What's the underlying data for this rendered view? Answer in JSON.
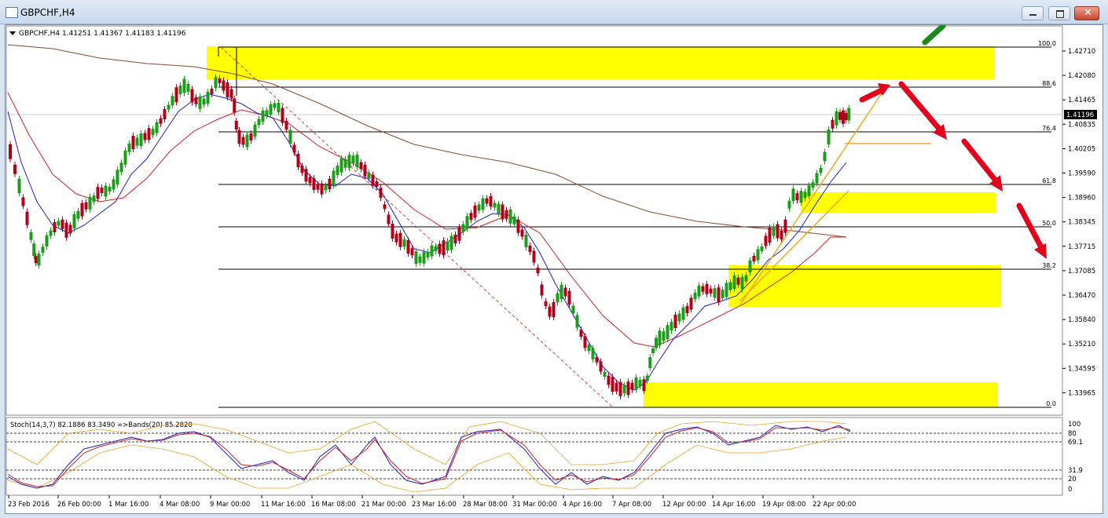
{
  "window": {
    "title": "GBPCHF,H4",
    "buttons": [
      "minimize",
      "maximize",
      "close"
    ]
  },
  "chart": {
    "info_line": "GBPCHF,H4  1.41251 1.41367 1.41183 1.41196",
    "current_price": "1.41196",
    "price_ticks": [
      "1.42710",
      "1.42080",
      "1.41465",
      "1.40835",
      "1.40205",
      "1.39590",
      "1.38960",
      "1.38345",
      "1.37715",
      "1.37085",
      "1.36470",
      "1.35840",
      "1.35210",
      "1.34595",
      "1.33965"
    ],
    "fib_levels": [
      "100.0",
      "88.6",
      "76.4",
      "61.8",
      "50.0",
      "38.2",
      "0.0"
    ],
    "time_labels": [
      "23 Feb 2016",
      "26 Feb 00:00",
      "1 Mar 16:00",
      "4 Mar 08:00",
      "9 Mar 00:00",
      "11 Mar 16:00",
      "16 Mar 08:00",
      "21 Mar 00:00",
      "23 Mar 16:00",
      "28 Mar 08:00",
      "31 Mar 00:00",
      "4 Apr 16:00",
      "7 Apr 08:00",
      "12 Apr 00:00",
      "14 Apr 16:00",
      "19 Apr 08:00",
      "22 Apr 00:00"
    ],
    "colors": {
      "up_candle": "#1a9e1a",
      "down_candle": "#b0001a",
      "zone": "#ffff00",
      "fast_ma": "#1e1ecc",
      "slow_ma": "#d42020",
      "long_ma": "#8b4a2b",
      "trendline": "#f5a623",
      "arrow_red": "#e3001b",
      "arrow_green": "#1b8a1b"
    }
  },
  "stochastic": {
    "info_line": "Stoch(14,3,7) 82.1886 83.3490  =>Bands(20) 85.2820",
    "ticks": [
      "100",
      "80",
      "69.1",
      "31.9",
      "20",
      "0"
    ]
  }
}
